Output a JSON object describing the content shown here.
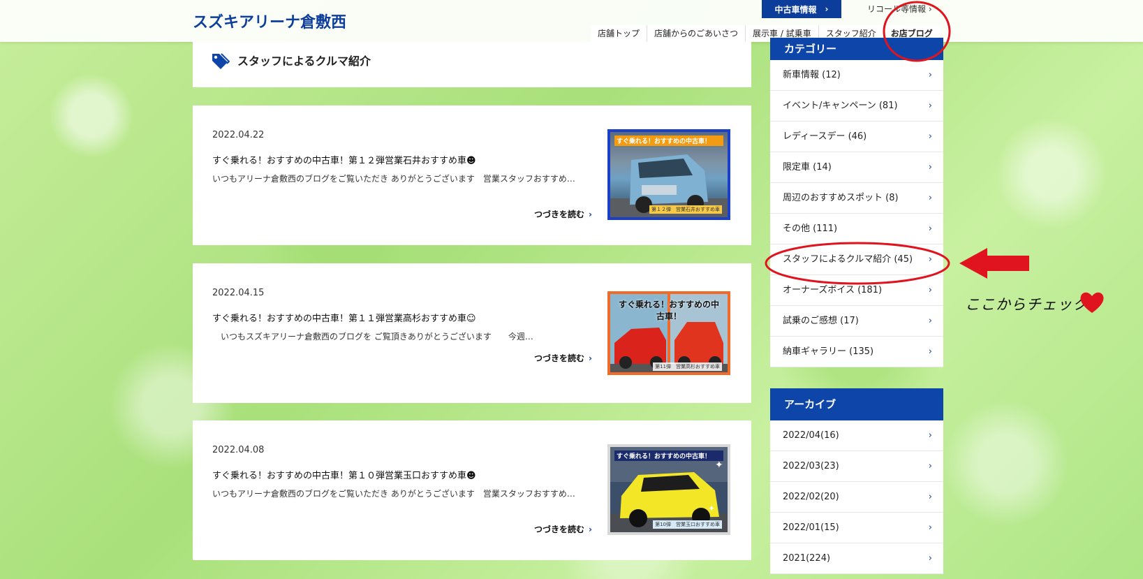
{
  "header": {
    "site_title": "スズキアリーナ倉敷西",
    "used_car_label": "中古車情報",
    "recall_label": "リコール等情報",
    "nav": [
      {
        "label": "店舗トップ"
      },
      {
        "label": "店舗からのごあいさつ"
      },
      {
        "label": "展示車 / 試乗車"
      },
      {
        "label": "スタッフ紹介"
      },
      {
        "label": "お店ブログ",
        "active": true
      }
    ]
  },
  "main": {
    "heading": "スタッフによるクルマ紹介",
    "posts": [
      {
        "date": "2022.04.22",
        "title": "すぐ乗れる！おすすめの中古車！第１２弾営業石井おすすめ車☻",
        "excerpt": "いつもアリーナ倉敷西のブログをご覧いただき ありがとうございます　営業スタッフおすすめ…",
        "more": "つづきを読む",
        "thumb_caption": "すぐ乗れる！おすすめの中古車！",
        "thumb_sub": "第１２弾　営業石井おすすめ車"
      },
      {
        "date": "2022.04.15",
        "title": "すぐ乗れる！おすすめの中古車！第１１弾営業高杉おすすめ車☺",
        "excerpt": "　いつもスズキアリーナ倉敷西のブログを ご覧頂きありがとうございます　　今週…",
        "more": "つづきを読む",
        "thumb_caption": "すぐ乗れる！おすすめの中古車！",
        "thumb_sub": "第11弾　営業高杉おすすめ車"
      },
      {
        "date": "2022.04.08",
        "title": "すぐ乗れる！おすすめの中古車！第１０弾営業玉口おすすめ車☻",
        "excerpt": "いつもアリーナ倉敷西のブログをご覧いただき ありがとうございます　営業スタッフおすすめ…",
        "more": "つづきを読む",
        "thumb_caption": "すぐ乗れる！おすすめの中古車！",
        "thumb_sub": "第10弾　営業玉口おすすめ車"
      }
    ]
  },
  "sidebar": {
    "categories_title": "カテゴリー",
    "categories": [
      {
        "label": "新車情報 (12)"
      },
      {
        "label": "イベント/キャンペーン (81)"
      },
      {
        "label": "レディースデー (46)"
      },
      {
        "label": "限定車 (14)"
      },
      {
        "label": "周辺のおすすめスポット (8)"
      },
      {
        "label": "その他 (111)"
      },
      {
        "label": "スタッフによるクルマ紹介 (45)"
      },
      {
        "label": "オーナーズボイス (181)"
      },
      {
        "label": "試乗のご感想 (17)"
      },
      {
        "label": "納車ギャラリー (135)"
      }
    ],
    "archive_title": "アーカイブ",
    "archives": [
      {
        "label": "2022/04(16)"
      },
      {
        "label": "2022/03(23)"
      },
      {
        "label": "2022/02(20)"
      },
      {
        "label": "2022/01(15)"
      },
      {
        "label": "2021(224)"
      }
    ]
  },
  "annotation": {
    "text": "ここからチェック",
    "color": "#e0141e"
  },
  "colors": {
    "brand_blue": "#0d46a8",
    "accent_red": "#e0141e"
  }
}
